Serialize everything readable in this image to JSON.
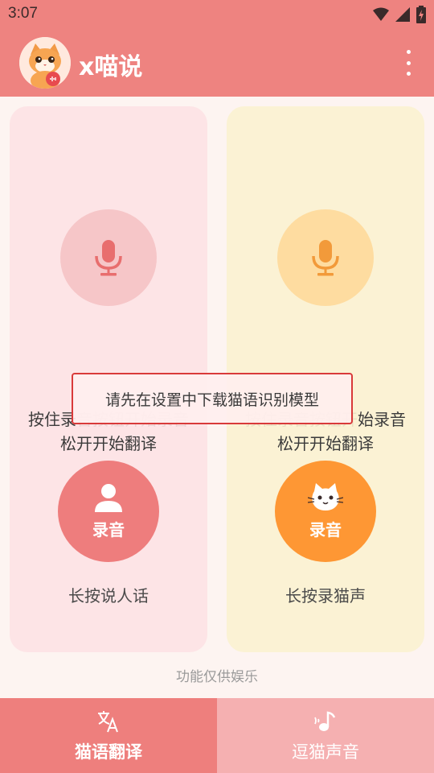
{
  "status": {
    "time": "3:07"
  },
  "app": {
    "title": "x喵说"
  },
  "cards": {
    "human": {
      "hint_faded_prefix": "按住录",
      "hint_faded": "音按钮开始录音",
      "hint_line2": "松开开始翻译",
      "record_label": "录音",
      "caption": "长按说人话"
    },
    "cat": {
      "hint_faded": "按住录音按钮开",
      "hint_visible": "始录音",
      "hint_line2": "松开开始翻译",
      "record_label": "录音",
      "caption": "长按录猫声"
    }
  },
  "toast": {
    "message": "请先在设置中下载猫语识别模型"
  },
  "footer_note": "功能仅供娱乐",
  "bottom_nav": [
    {
      "label": "猫语翻译",
      "icon": "translate-icon",
      "active": true
    },
    {
      "label": "逗猫声音",
      "icon": "music-note-icon",
      "active": false
    }
  ],
  "colors": {
    "primary": "#ee8380",
    "human_card": "#fde4e6",
    "cat_card": "#fbf2d4",
    "human_record": "#ee7d7d",
    "cat_record": "#fe9734"
  }
}
